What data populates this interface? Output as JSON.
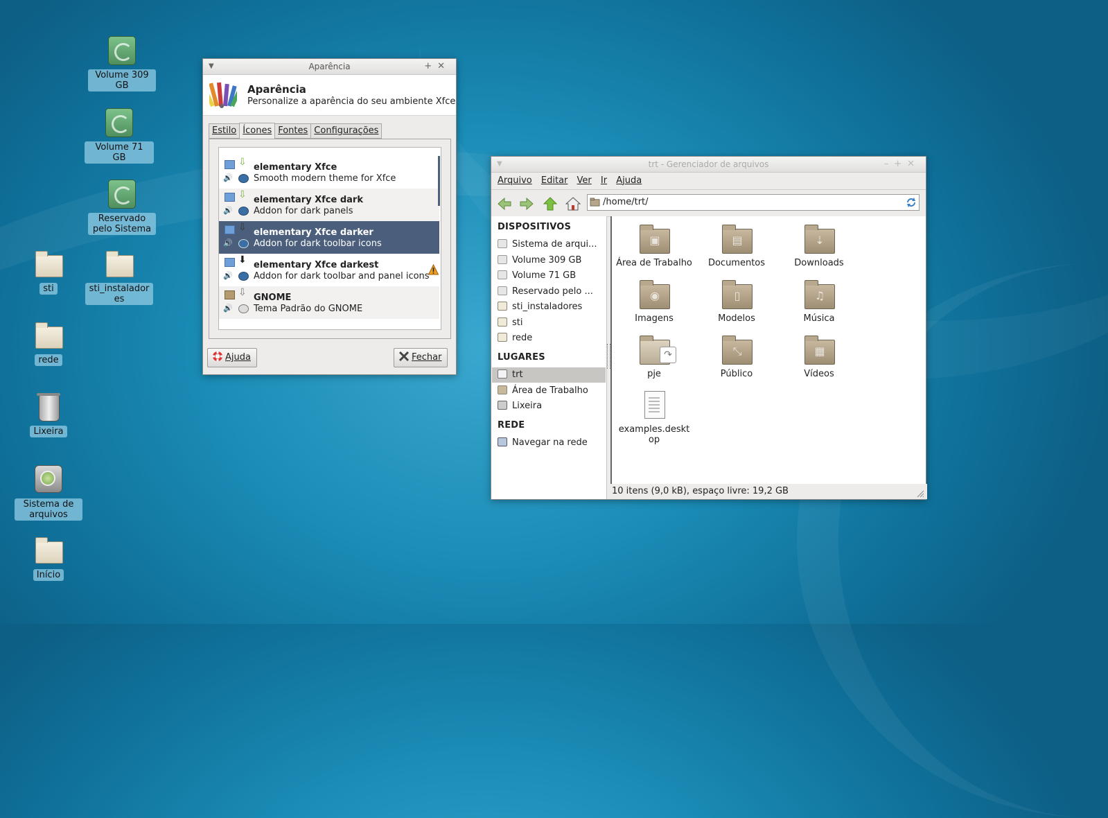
{
  "desktop": {
    "icons": [
      {
        "label": "Volume 309 GB",
        "icon": "drive-icon"
      },
      {
        "label": "Volume 71 GB",
        "icon": "drive-icon"
      },
      {
        "label": "Reservado pelo Sistema",
        "icon": "drive-icon"
      },
      {
        "label": "sti",
        "icon": "folder-icon"
      },
      {
        "label": "sti_instaladores",
        "icon": "folder-icon"
      },
      {
        "label": "rede",
        "icon": "folder-icon"
      },
      {
        "label": "Lixeira",
        "icon": "trash-icon"
      },
      {
        "label": "Sistema de arquivos",
        "icon": "hard-disk-icon"
      },
      {
        "label": "Início",
        "icon": "folder-icon"
      }
    ]
  },
  "appearance": {
    "window_title": "Aparência",
    "header_title": "Aparência",
    "header_subtitle": "Personalize a aparência do seu ambiente Xfce",
    "tabs": [
      "Estilo",
      "Ícones",
      "Fontes",
      "Configurações"
    ],
    "active_tab": "Ícones",
    "themes": [
      {
        "name": "elementary Xfce",
        "desc": "Smooth modern theme for Xfce",
        "selected": false
      },
      {
        "name": "elementary Xfce dark",
        "desc": "Addon for dark panels",
        "selected": false
      },
      {
        "name": "elementary Xfce darker",
        "desc": "Addon for dark toolbar icons",
        "selected": true
      },
      {
        "name": "elementary Xfce darkest",
        "desc": "Addon for dark toolbar and panel icons",
        "selected": false,
        "warning": true
      },
      {
        "name": "GNOME",
        "desc": "Tema Padrão do GNOME",
        "selected": false
      }
    ],
    "help_button": "Ajuda",
    "close_button": "Fechar"
  },
  "filemanager": {
    "window_title": "trt - Gerenciador de arquivos",
    "menu": [
      "Arquivo",
      "Editar",
      "Ver",
      "Ir",
      "Ajuda"
    ],
    "path": "/home/trt/",
    "sidebar": {
      "devices_header": "DISPOSITIVOS",
      "devices": [
        "Sistema de arqui...",
        "Volume 309 GB",
        "Volume 71 GB",
        "Reservado pelo ...",
        "sti_instaladores",
        "sti",
        "rede"
      ],
      "places_header": "LUGARES",
      "places": [
        "trt",
        "Área de Trabalho",
        "Lixeira"
      ],
      "network_header": "REDE",
      "network": [
        "Navegar na rede"
      ]
    },
    "files": [
      {
        "name": "Área de Trabalho",
        "kind": "folder",
        "glyph": "▣"
      },
      {
        "name": "Documentos",
        "kind": "folder",
        "glyph": "▤"
      },
      {
        "name": "Downloads",
        "kind": "folder",
        "glyph": "⇣"
      },
      {
        "name": "Imagens",
        "kind": "folder",
        "glyph": "◉"
      },
      {
        "name": "Modelos",
        "kind": "folder",
        "glyph": "▯"
      },
      {
        "name": "Música",
        "kind": "folder",
        "glyph": "♫"
      },
      {
        "name": "pje",
        "kind": "link-folder",
        "glyph": ""
      },
      {
        "name": "Público",
        "kind": "folder",
        "glyph": "⤡"
      },
      {
        "name": "Vídeos",
        "kind": "folder",
        "glyph": "▦"
      },
      {
        "name": "examples.desktop",
        "kind": "file",
        "glyph": ""
      }
    ],
    "status": "10 itens (9,0 kB), espaço livre: 19,2 GB"
  }
}
